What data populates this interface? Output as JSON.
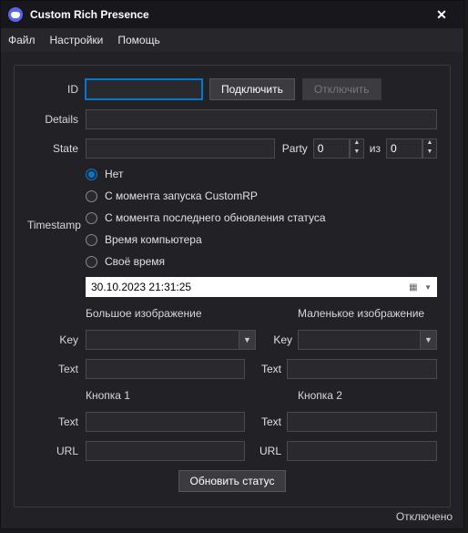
{
  "window": {
    "title": "Custom Rich Presence"
  },
  "menu": {
    "file": "Файл",
    "settings": "Настройки",
    "help": "Помощь"
  },
  "labels": {
    "id": "ID",
    "details": "Details",
    "state": "State",
    "party": "Party",
    "of": "из",
    "timestamp": "Timestamp",
    "bigimg": "Большое изображение",
    "smallimg": "Маленькое изображение",
    "key": "Key",
    "text": "Text",
    "btn1": "Кнопка 1",
    "btn2": "Кнопка 2",
    "url": "URL"
  },
  "buttons": {
    "connect": "Подключить",
    "disconnect": "Отключить",
    "update": "Обновить статус"
  },
  "party": {
    "current": "0",
    "max": "0"
  },
  "radios": [
    "Нет",
    "С момента запуска CustomRP",
    "С момента последнего обновления статуса",
    "Время компьютера",
    "Своё время"
  ],
  "datetime": "30.10.2023 21:31:25",
  "status": "Отключено"
}
